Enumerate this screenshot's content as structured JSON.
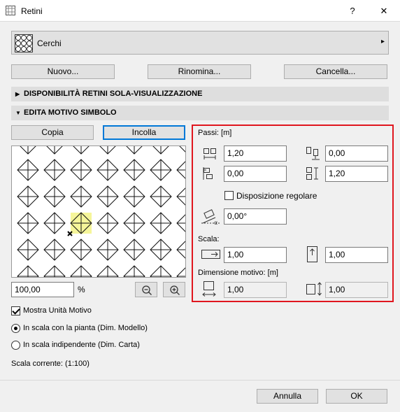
{
  "window": {
    "title": "Retini",
    "help_label": "?",
    "close_label": "✕"
  },
  "pattern_selector": {
    "name": "Cerchi",
    "icon": "grid-circles-icon",
    "arrow": "▸"
  },
  "buttons": {
    "new": "Nuovo...",
    "rename": "Rinomina...",
    "delete": "Cancella...",
    "copy": "Copia",
    "paste": "Incolla",
    "cancel": "Annulla",
    "ok": "OK"
  },
  "sections": {
    "view_only": "DISPONIBILITÀ RETINI SOLA-VISUALIZZAZIONE",
    "edit_symbol": "EDITA MOTIVO SIMBOLO"
  },
  "preview": {
    "zoom_value": "100,00",
    "zoom_unit": "%",
    "zoom_out_icon": "zoom-out-icon",
    "zoom_in_icon": "zoom-in-icon",
    "highlight_color": "#f5f59a"
  },
  "spacing": {
    "title": "Passi: [m]",
    "h1": "1,20",
    "v_offset": "0,00",
    "h_offset": "0,00",
    "v1": "1,20",
    "regular_label": "Disposizione regolare",
    "regular_checked": false,
    "angle": "0,00°"
  },
  "scale": {
    "title": "Scala:",
    "x": "1,00",
    "y": "1,00"
  },
  "motif_size": {
    "title": "Dimensione motivo: [m]",
    "width": "1,00",
    "height": "1,00"
  },
  "options": {
    "show_unit_label": "Mostra Unità Motivo",
    "show_unit_checked": true,
    "model_scale_label": "In scala con la pianta (Dim. Modello)",
    "paper_scale_label": "In scala indipendente (Dim. Carta)",
    "current_scale": "Scala corrente: (1:100)"
  },
  "colors": {
    "accent": "#0078d7",
    "highlight_border": "#e0161e"
  }
}
